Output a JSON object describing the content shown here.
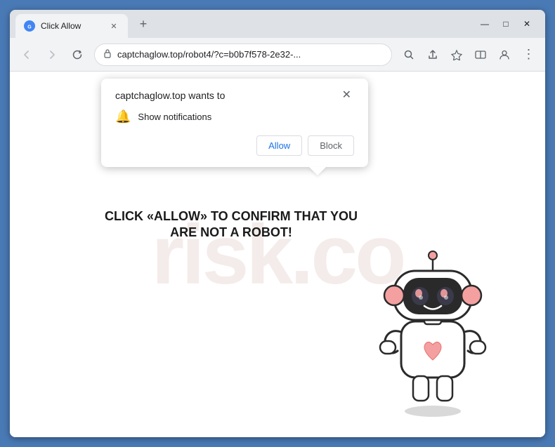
{
  "browser": {
    "tab_favicon": "●",
    "tab_title": "Click Allow",
    "tab_close": "✕",
    "new_tab": "+",
    "window_min": "—",
    "window_max": "□",
    "window_close": "✕",
    "nav_back": "←",
    "nav_forward": "→",
    "nav_refresh": "↻",
    "address_lock": "🔒",
    "address_url": "captchaglow.top/robot4/?c=b0b7f578-2e32-...",
    "toolbar_search": "🔍",
    "toolbar_share": "⬆",
    "toolbar_star": "☆",
    "toolbar_split": "⬜",
    "toolbar_profile": "👤",
    "toolbar_menu": "⋮"
  },
  "popup": {
    "title": "captchaglow.top wants to",
    "close": "✕",
    "notification_label": "Show notifications",
    "allow_label": "Allow",
    "block_label": "Block"
  },
  "page": {
    "main_message": "CLICK «ALLOW» TO CONFIRM THAT YOU ARE NOT A ROBOT!",
    "watermark": "risk.co"
  }
}
